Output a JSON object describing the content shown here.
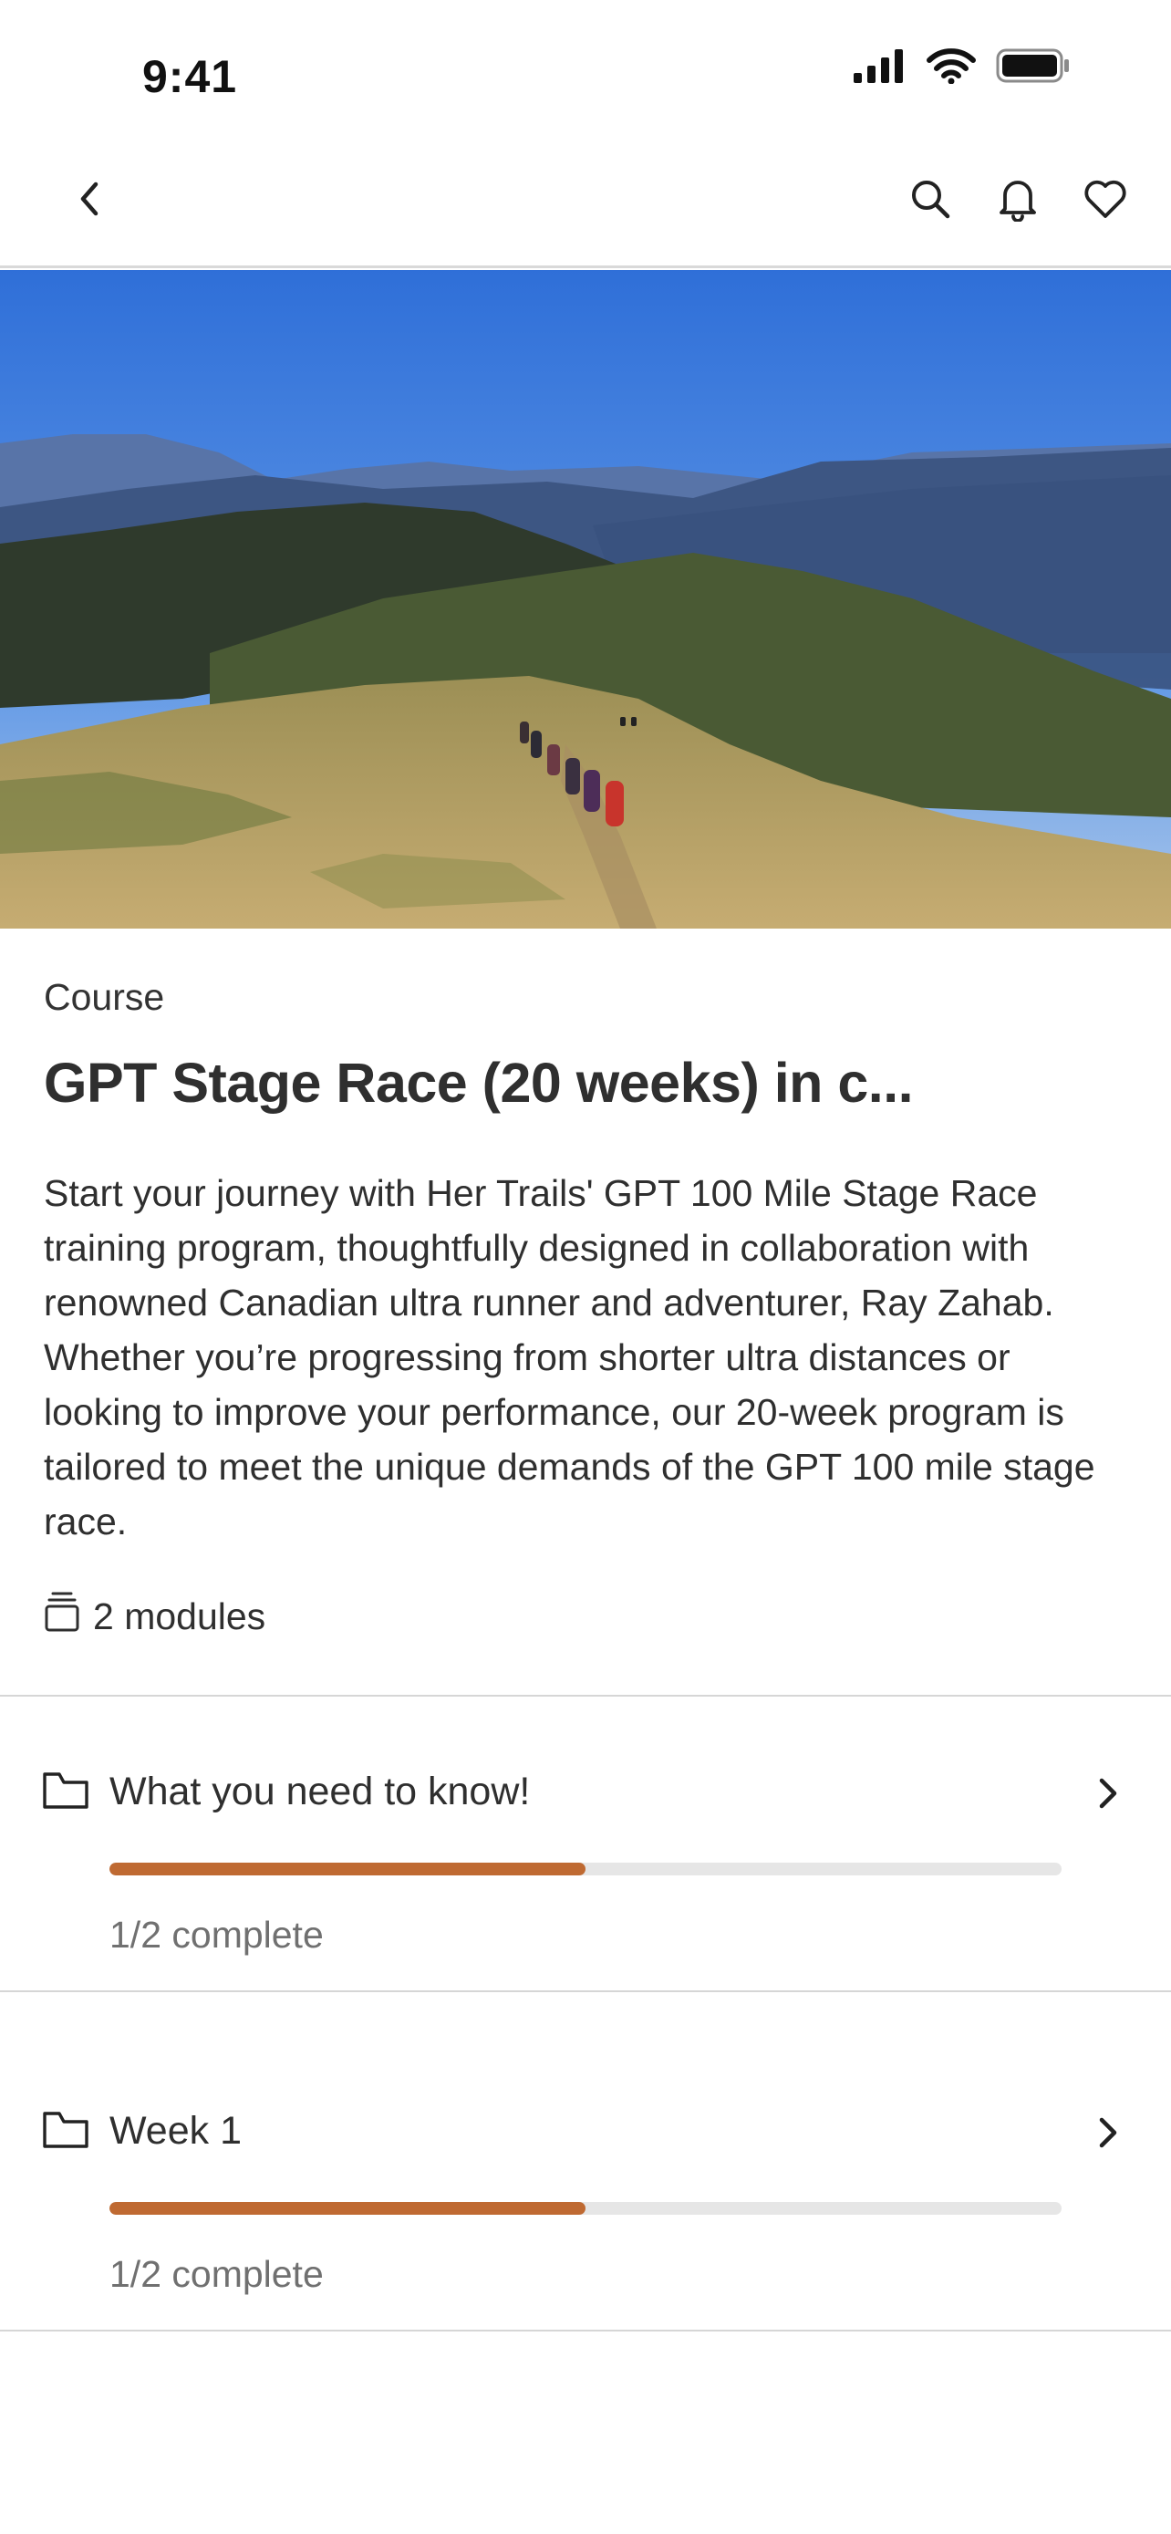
{
  "status_bar": {
    "time": "9:41"
  },
  "nav": {
    "back_icon": "chevron-left-icon",
    "actions": [
      "search-icon",
      "bell-icon",
      "heart-icon"
    ]
  },
  "course": {
    "kicker": "Course",
    "title": "GPT Stage Race (20 weeks) in c...",
    "description": "Start your journey with Her Trails' GPT 100 Mile Stage Race training program, thoughtfully designed in collaboration with renowned Canadian ultra runner and adventurer, Ray Zahab. Whether you’re progressing from shorter ultra distances or looking to improve your performance, our 20-week program is tailored to meet the unique demands of the GPT 100 mile stage race.",
    "modules_count": "2 modules"
  },
  "modules": [
    {
      "label": "What you need to know!",
      "status": "1/2 complete",
      "progress": 0.5
    },
    {
      "label": "Week 1",
      "status": "1/2 complete",
      "progress": 0.5
    }
  ],
  "colors": {
    "accent": "#bf6a32",
    "track": "#e6e6e6",
    "divider": "#d6d6d6"
  }
}
